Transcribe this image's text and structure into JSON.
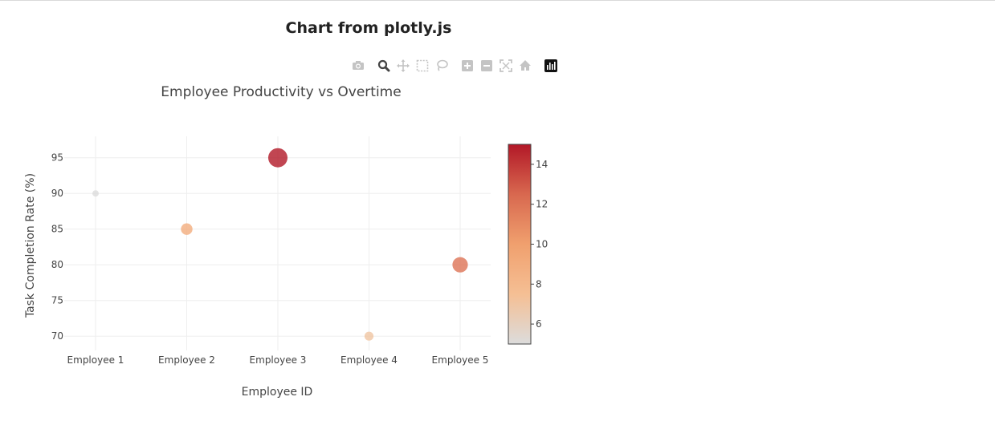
{
  "page": {
    "heading": "Chart from plotly.js"
  },
  "modebar": {
    "buttons": [
      {
        "icon": "camera-icon"
      },
      {
        "icon": "zoom-icon"
      },
      {
        "icon": "pan-icon"
      },
      {
        "icon": "box-select-icon"
      },
      {
        "icon": "lasso-icon"
      },
      {
        "icon": "zoom-in-icon"
      },
      {
        "icon": "zoom-out-icon"
      },
      {
        "icon": "autoscale-icon"
      },
      {
        "icon": "reset-axes-icon"
      },
      {
        "icon": "plotly-logo-icon"
      }
    ],
    "active": "zoom-icon",
    "icon_color": "#c4c4c4",
    "active_color": "#444444"
  },
  "chart_data": {
    "type": "scatter",
    "title": "Employee Productivity vs Overtime",
    "xlabel": "Employee ID",
    "ylabel": "Task Completion Rate (%)",
    "categories": [
      "Employee 1",
      "Employee 2",
      "Employee 3",
      "Employee 4",
      "Employee 5"
    ],
    "values": [
      90,
      85,
      95,
      70,
      80
    ],
    "color_values": [
      5,
      9,
      15,
      7,
      12
    ],
    "ylim": [
      68,
      98
    ],
    "yticks": [
      70,
      75,
      80,
      85,
      90,
      95
    ],
    "grid": true,
    "colorbar": {
      "range": [
        5,
        15
      ],
      "ticks": [
        6,
        8,
        10,
        12,
        14
      ],
      "colorscale": [
        "#dcdcdc",
        "#f5bf94",
        "#f0a06e",
        "#d8684f",
        "#b21827"
      ]
    }
  }
}
